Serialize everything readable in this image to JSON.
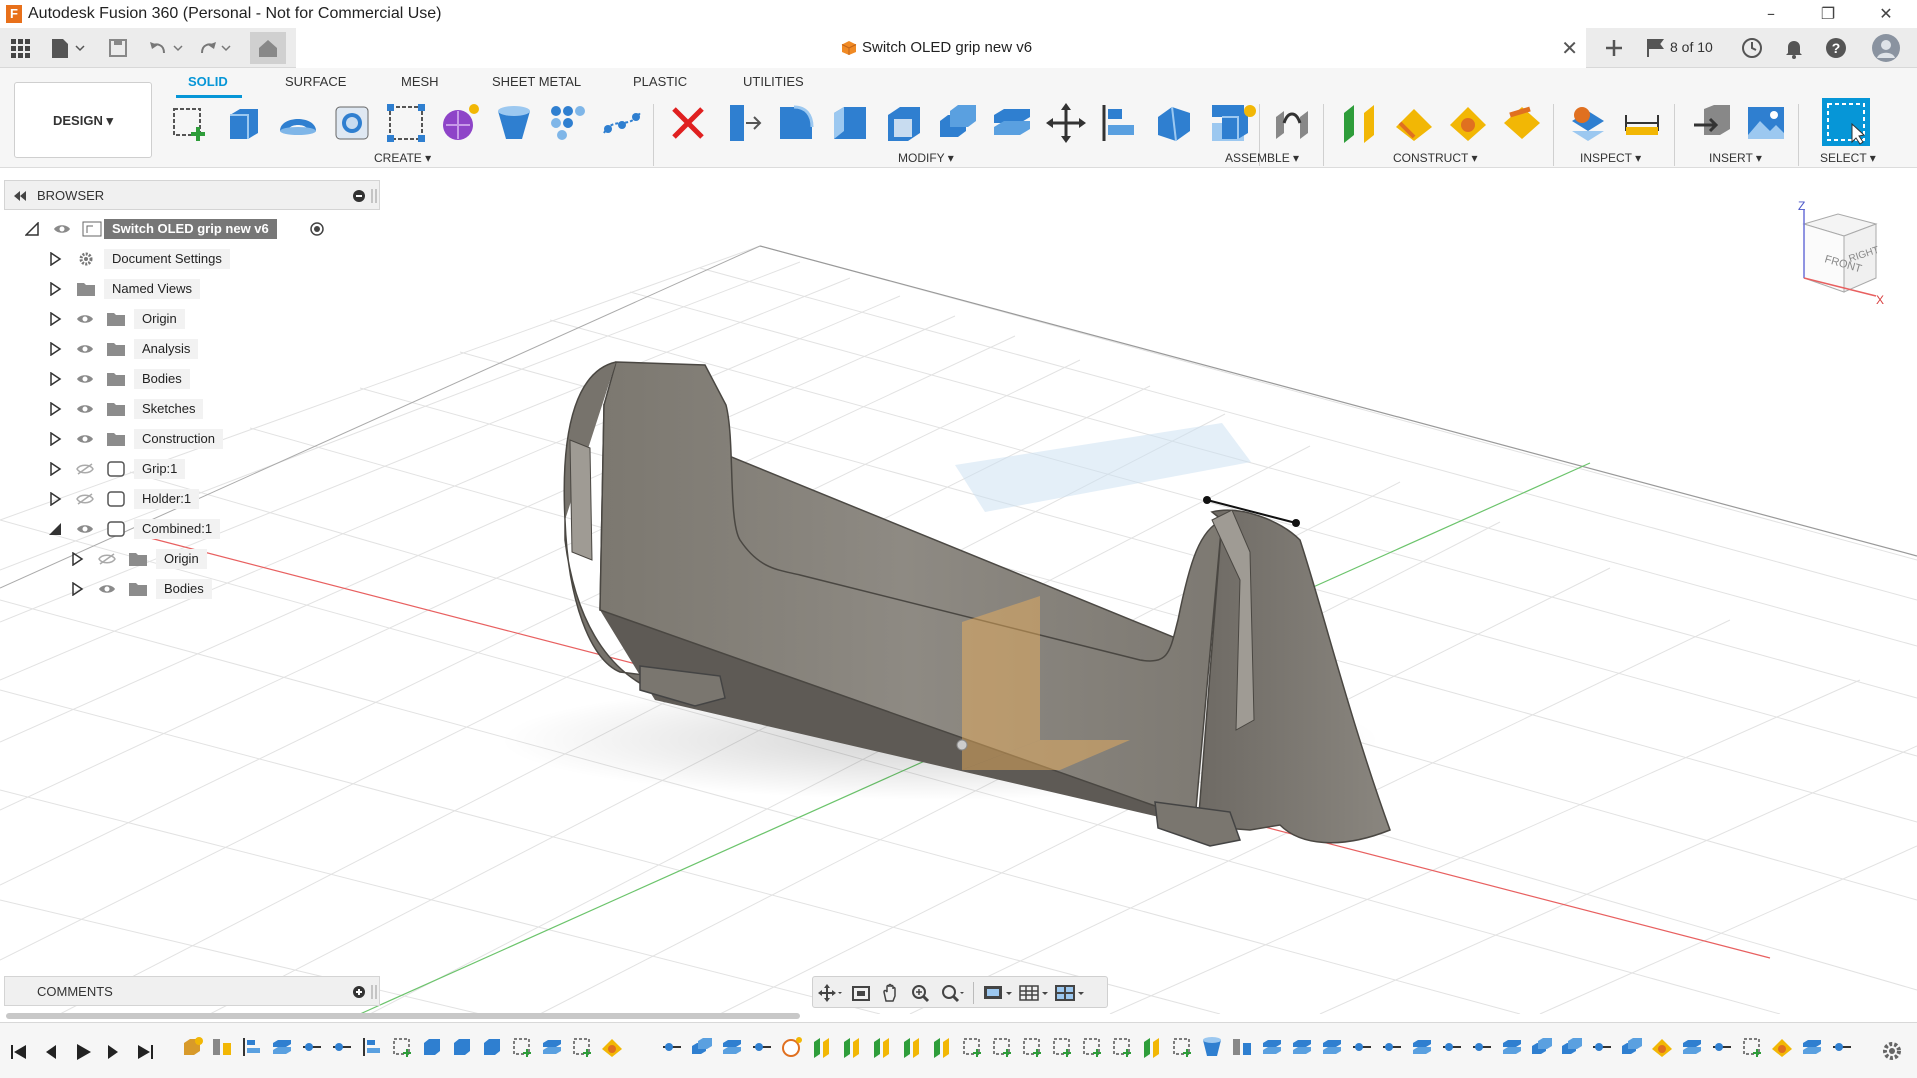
{
  "window": {
    "title": "Autodesk Fusion 360 (Personal - Not for Commercial Use)",
    "minimize": "–",
    "maximize": "❐",
    "close": "✕"
  },
  "document_tab": {
    "title": "Switch OLED grip new v6",
    "close": "✕",
    "version_count": "8 of 10"
  },
  "ribbon": {
    "workspace": "DESIGN ▾",
    "tabs": [
      "SOLID",
      "SURFACE",
      "MESH",
      "SHEET METAL",
      "PLASTIC",
      "UTILITIES"
    ],
    "active_tab": "SOLID",
    "groups": [
      "CREATE ▾",
      "MODIFY ▾",
      "ASSEMBLE ▾",
      "CONSTRUCT ▾",
      "INSPECT ▾",
      "INSERT ▾",
      "SELECT ▾"
    ]
  },
  "browser": {
    "title": "BROWSER",
    "root": "Switch OLED grip new v6",
    "items": [
      {
        "label": "Document Settings",
        "icon": "gear-icon",
        "visible": null
      },
      {
        "label": "Named Views",
        "icon": "folder-icon",
        "visible": null
      },
      {
        "label": "Origin",
        "icon": "folder-icon",
        "visible": true
      },
      {
        "label": "Analysis",
        "icon": "folder-icon",
        "visible": true
      },
      {
        "label": "Bodies",
        "icon": "folder-icon",
        "visible": true
      },
      {
        "label": "Sketches",
        "icon": "folder-icon",
        "visible": true
      },
      {
        "label": "Construction",
        "icon": "folder-icon",
        "visible": true
      },
      {
        "label": "Grip:1",
        "icon": "component-icon",
        "visible": false
      },
      {
        "label": "Holder:1",
        "icon": "component-icon",
        "visible": false
      },
      {
        "label": "Combined:1",
        "icon": "component-icon",
        "visible": true,
        "expanded": true
      },
      {
        "label": "Origin",
        "icon": "folder-icon",
        "visible": false,
        "child": true
      },
      {
        "label": "Bodies",
        "icon": "folder-icon",
        "visible": true,
        "child": true
      }
    ]
  },
  "viewcube": {
    "front": "FRONT",
    "right": "RIGHT",
    "z_axis": "Z",
    "x_axis": "X"
  },
  "comments": {
    "title": "COMMENTS"
  },
  "colors": {
    "accent": "#0696d7",
    "model": "#8e8a83",
    "grid": "#dcdcdc",
    "brand": "#e8701a",
    "plane": "#f3b35c"
  }
}
